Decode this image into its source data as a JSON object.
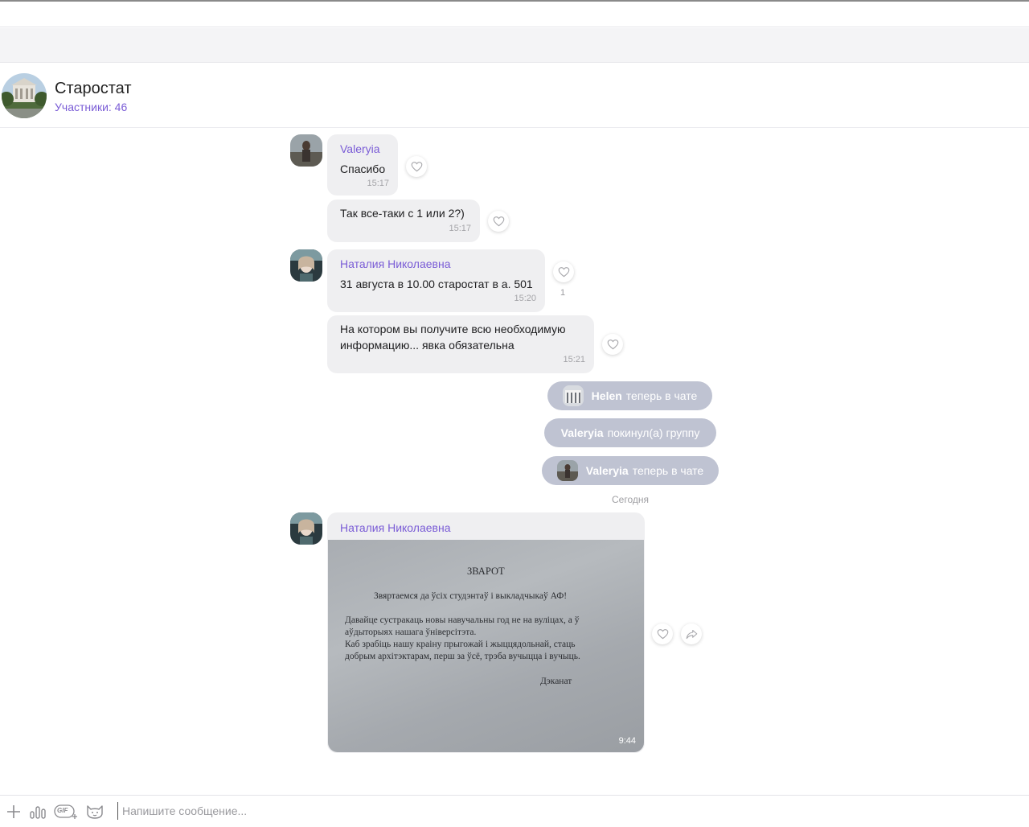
{
  "chat": {
    "title": "Старостат",
    "members": "Участники: 46"
  },
  "messages": [
    {
      "sender": "Valeryia",
      "text": "Спасибо",
      "time": "15:17"
    },
    {
      "text": "Так все-таки с 1 или 2?)",
      "time": "15:17"
    },
    {
      "sender": "Наталия Николаевна",
      "text": "31 августа в 10.00 старостат в а. 501",
      "time": "15:20",
      "likes": "1"
    },
    {
      "text_line1": "На котором вы получите всю необходимую",
      "text_line2": "информацию... явка обязательна",
      "time": "15:21"
    }
  ],
  "system": [
    {
      "name": "Helen",
      "text": "теперь в чате"
    },
    {
      "name": "Valeryia",
      "text": "покинул(а) группу"
    },
    {
      "name": "Valeryia",
      "text": "теперь в чате"
    }
  ],
  "date_separator": "Сегодня",
  "photo_message": {
    "sender": "Наталия Николаевна",
    "time": "9:44",
    "doc_title": "ЗВАРОТ",
    "doc_line1": "Звяртаемся да ўсіх студэнтаў і выкладчыкаў АФ!",
    "doc_line2": "Давайце сустракаць новы навучальны год не на вуліцах, а ў",
    "doc_line3": "аўдыторыях нашага ўніверсітэта.",
    "doc_line4": "Каб зрабіць нашу краіну прыгожай і жыццядольнай, стаць",
    "doc_line5": "добрым архітэктарам, перш за ўсё, трэба вучыцца і вучыць.",
    "doc_sign": "Дэканат"
  },
  "composer": {
    "placeholder": "Напишите сообщение...",
    "gif_label": "GIF"
  },
  "colors": {
    "accent": "#7a5cd6",
    "bubble": "#efeff1",
    "system_pill": "#bfc3d2"
  }
}
